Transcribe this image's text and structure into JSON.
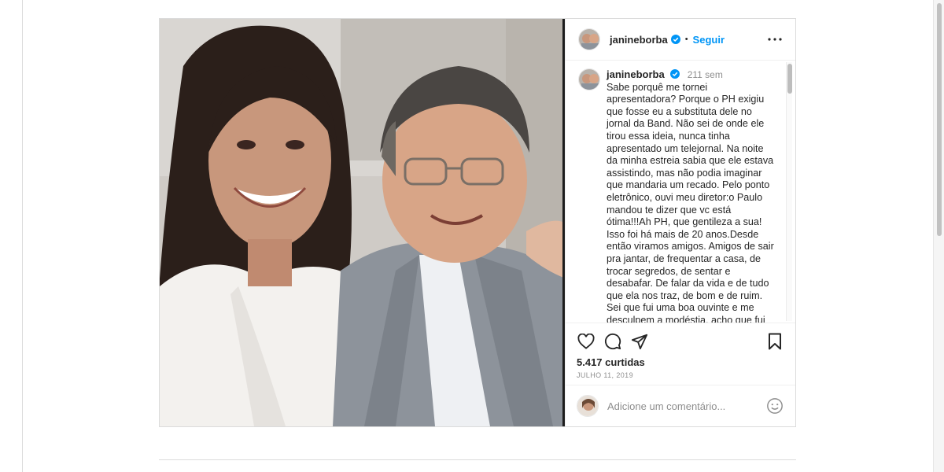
{
  "post": {
    "username": "janineborba",
    "follow_label": "Seguir",
    "dot": "•",
    "caption": {
      "username": "janineborba",
      "time": "211 sem",
      "text": "Sabe porquê me tornei\napresentadora? Porque o PH exigiu\nque fosse eu a substituta dele no\njornal da Band. Não sei de onde ele\ntirou essa ideia, nunca tinha\napresentado um telejornal. Na noite\nda minha estreia sabia que ele estava\nassistindo, mas não podia imaginar\nque mandaria um recado. Pelo ponto\neletrônico, ouvi meu diretor:o Paulo\nmandou te dizer que vc está\nótima!!!Ah PH, que gentileza a sua!\nIsso foi há mais de 20 anos.Desde\nentão viramos amigos. Amigos de sair\npra jantar, de frequentar a casa, de\ntrocar segredos, de sentar e\ndesabafar. De falar da vida e de tudo\nque ela nos traz, de bom e de ruim.\nSei que fui uma boa ouvinte e me\ndesculpem a modéstia, acho que fui"
    },
    "likes": "5.417 curtidas",
    "date": "JULHO 11, 2019",
    "comment_placeholder": "Adicione um comentário...",
    "icons": {
      "more": "more-options-icon",
      "like": "heart-icon",
      "comment": "comment-bubble-icon",
      "share": "paper-plane-icon",
      "save": "bookmark-icon",
      "emoji": "smiley-icon",
      "verified": "verified-badge-icon"
    },
    "colors": {
      "link": "#0095f6",
      "verified": "#0095f6",
      "muted": "#8e8e8e",
      "text": "#262626",
      "border": "#dbdbdb"
    }
  }
}
